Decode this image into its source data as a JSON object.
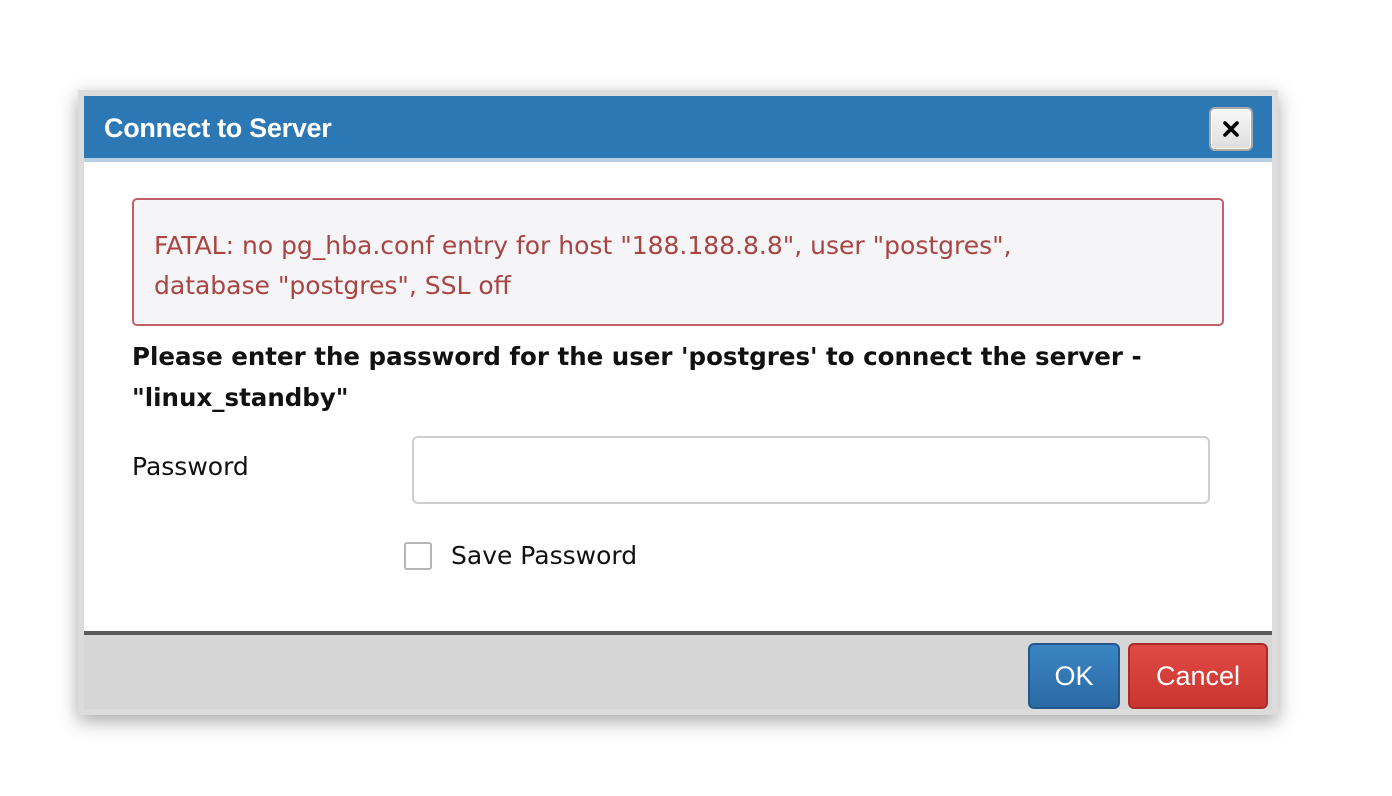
{
  "dialog": {
    "title": "Connect to Server",
    "close_icon": "close-icon"
  },
  "error": {
    "line1": "FATAL: no pg_hba.conf entry for host \"188.188.8.8\", user \"postgres\",",
    "line2": "database \"postgres\", SSL off"
  },
  "prompt": {
    "line1": "Please enter the password for the user 'postgres' to connect the server -",
    "line2": "\"linux_standby\""
  },
  "form": {
    "password_label": "Password",
    "password_value": "",
    "save_password_label": "Save Password",
    "save_password_checked": false
  },
  "footer": {
    "ok_label": "OK",
    "cancel_label": "Cancel"
  },
  "colors": {
    "titlebar": "#2c78b4",
    "error_text": "#a94442",
    "ok_button": "#2f76b5",
    "cancel_button": "#d43f3a"
  }
}
